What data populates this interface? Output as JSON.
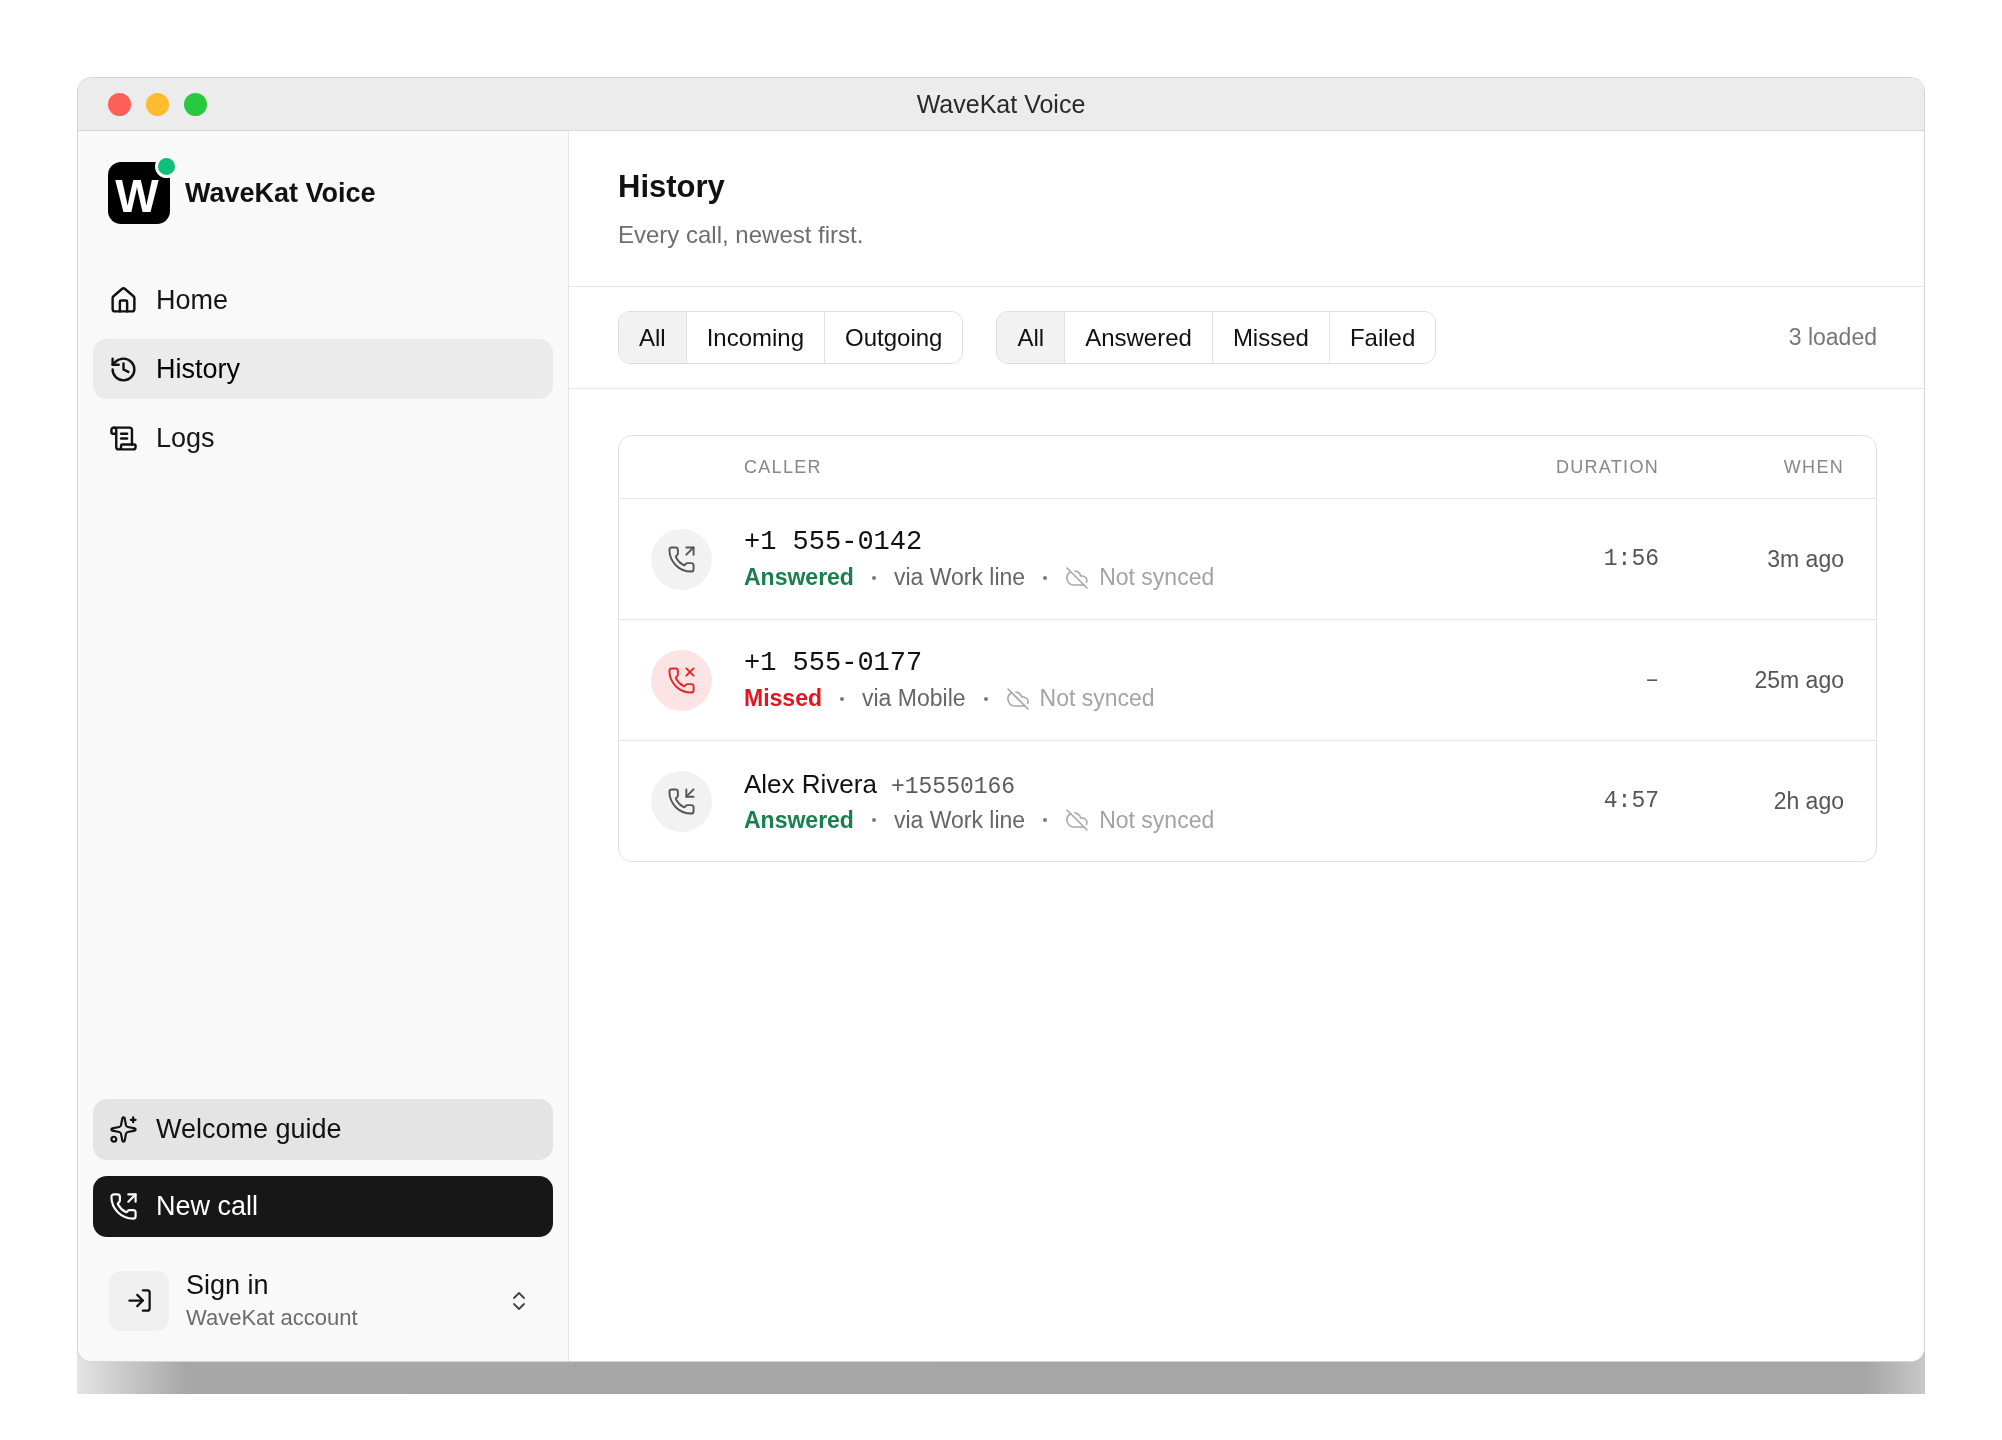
{
  "window": {
    "title": "WaveKat Voice"
  },
  "sidebar": {
    "brand": {
      "logo_letter": "W",
      "name": "WaveKat Voice",
      "online": true
    },
    "nav": [
      {
        "kind": "home",
        "label": "Home",
        "selected": false
      },
      {
        "kind": "history",
        "label": "History",
        "selected": true
      },
      {
        "kind": "logs",
        "label": "Logs",
        "selected": false
      }
    ],
    "guide_button": {
      "label": "Welcome guide"
    },
    "new_call_button": {
      "label": "New call"
    },
    "account": {
      "title": "Sign in",
      "subtitle": "WaveKat account"
    }
  },
  "page": {
    "title": "History",
    "subtitle": "Every call, newest first."
  },
  "filters": {
    "direction": [
      {
        "label": "All",
        "selected": true
      },
      {
        "label": "Incoming",
        "selected": false
      },
      {
        "label": "Outgoing",
        "selected": false
      }
    ],
    "status": [
      {
        "label": "All",
        "selected": true
      },
      {
        "label": "Answered",
        "selected": false
      },
      {
        "label": "Missed",
        "selected": false
      },
      {
        "label": "Failed",
        "selected": false
      }
    ],
    "count": "3 loaded"
  },
  "table": {
    "columns": [
      "CALLER",
      "DURATION",
      "WHEN"
    ],
    "rows": [
      {
        "kind": "outgoing",
        "caller": {
          "kind": "number",
          "name": "+1 555-0142"
        },
        "status": {
          "label": "Answered",
          "color": "#17804d"
        },
        "line": "via Work line",
        "synced": false,
        "sync_label": "Not synced",
        "duration": "1:56",
        "when": "3m ago"
      },
      {
        "kind": "missed",
        "caller": {
          "kind": "number",
          "name": "+1 555-0177"
        },
        "status": {
          "label": "Missed",
          "color": "#e3141c"
        },
        "line": "via Mobile",
        "synced": false,
        "sync_label": "Not synced",
        "duration": "–",
        "when": "25m ago"
      },
      {
        "kind": "incoming",
        "caller": {
          "kind": "contact",
          "name": "Alex Rivera",
          "number": "+15550166"
        },
        "status": {
          "label": "Answered",
          "color": "#17804d"
        },
        "line": "via Work line",
        "synced": false,
        "sync_label": "Not synced",
        "duration": "4:57",
        "when": "2h ago"
      }
    ]
  }
}
